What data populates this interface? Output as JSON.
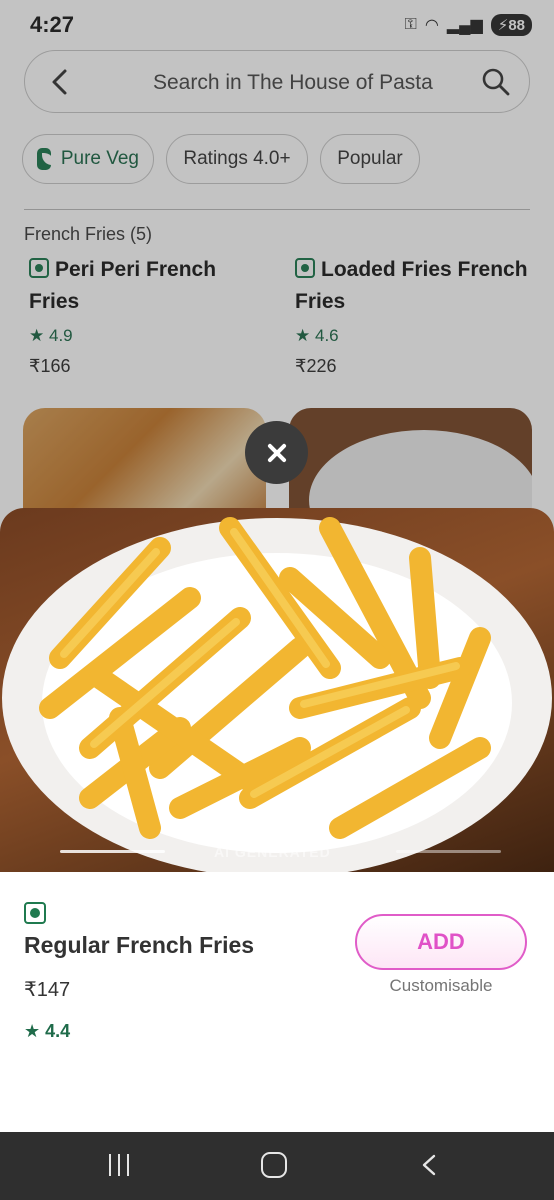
{
  "status_bar": {
    "time": "4:27",
    "battery": "88",
    "icons": [
      "key-icon",
      "wifi-icon",
      "signal-icon",
      "battery-icon"
    ]
  },
  "search": {
    "placeholder": "Search in The House of Pasta"
  },
  "filters": [
    {
      "label": "Pure Veg"
    },
    {
      "label": "Ratings 4.0+"
    },
    {
      "label": "Popular"
    }
  ],
  "section_title": "French Fries (5)",
  "cards": [
    {
      "name": "Peri Peri French Fries",
      "rating": "4.9",
      "price": "₹166"
    },
    {
      "name": "Loaded Fries French Fries",
      "rating": "4.6",
      "price": "₹226"
    }
  ],
  "hero": {
    "watermark": "AI GENERATED"
  },
  "item": {
    "title": "Regular French Fries",
    "price": "₹147",
    "rating": "4.4",
    "add_label": "ADD",
    "customisable": "Customisable"
  },
  "colors": {
    "veg_green": "#1f7a4f",
    "add_pink": "#e052c7",
    "nav_bar": "#2f2f2f"
  }
}
